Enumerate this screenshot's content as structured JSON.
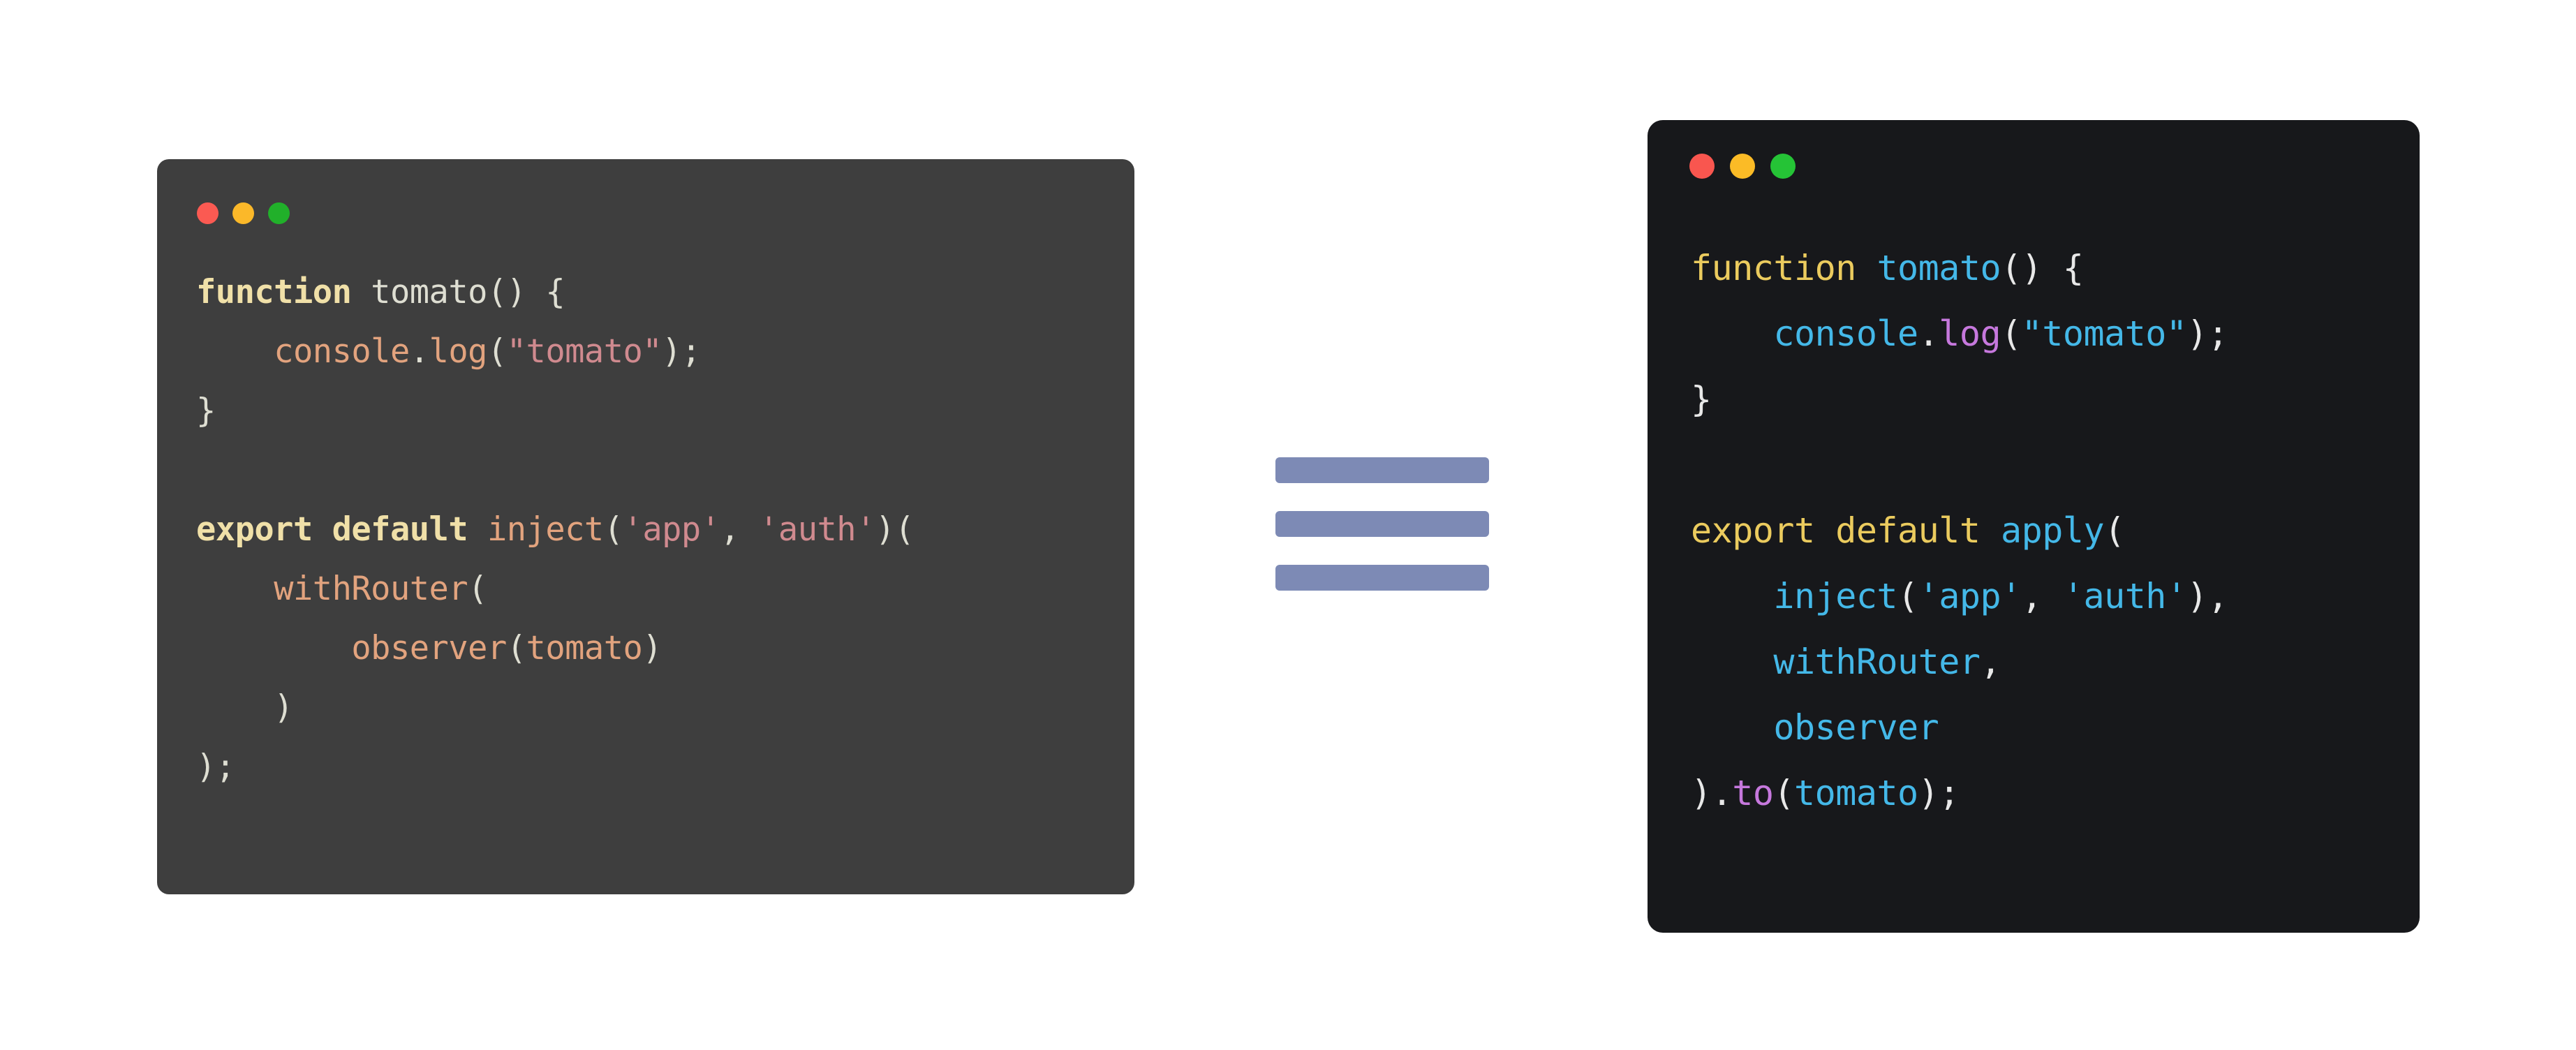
{
  "background_color": "#FFFFFF",
  "left_window": {
    "name": "before-code-window",
    "background_color": "#3E3E3E",
    "traffic_lights": [
      {
        "name": "close-dot",
        "color": "#FB5A52"
      },
      {
        "name": "minimize-dot",
        "color": "#FBB829"
      },
      {
        "name": "maximize-dot",
        "color": "#21B02A"
      }
    ],
    "language": "javascript",
    "code_text": "function tomato() {\n    console.log(\"tomato\");\n}\n\nexport default inject('app', 'auth')(\n    withRouter(\n        observer(tomato)\n    )\n);",
    "lines": [
      {
        "tokens": [
          {
            "text": "function",
            "type": "keyword"
          },
          {
            "text": " ",
            "type": "plain"
          },
          {
            "text": "tomato",
            "type": "plain"
          },
          {
            "text": "() {",
            "type": "punct"
          }
        ]
      },
      {
        "tokens": [
          {
            "text": "    ",
            "type": "plain"
          },
          {
            "text": "console",
            "type": "func"
          },
          {
            "text": ".",
            "type": "punct"
          },
          {
            "text": "log",
            "type": "func"
          },
          {
            "text": "(",
            "type": "punct"
          },
          {
            "text": "\"tomato\"",
            "type": "string"
          },
          {
            "text": ");",
            "type": "punct"
          }
        ]
      },
      {
        "tokens": [
          {
            "text": "}",
            "type": "punct"
          }
        ]
      },
      {
        "blank": true,
        "tokens": []
      },
      {
        "tokens": [
          {
            "text": "export default",
            "type": "keyword"
          },
          {
            "text": " ",
            "type": "plain"
          },
          {
            "text": "inject",
            "type": "func"
          },
          {
            "text": "(",
            "type": "punct"
          },
          {
            "text": "'app'",
            "type": "string"
          },
          {
            "text": ", ",
            "type": "punct"
          },
          {
            "text": "'auth'",
            "type": "string"
          },
          {
            "text": ")(",
            "type": "punct"
          }
        ]
      },
      {
        "tokens": [
          {
            "text": "    ",
            "type": "plain"
          },
          {
            "text": "withRouter",
            "type": "func"
          },
          {
            "text": "(",
            "type": "punct"
          }
        ]
      },
      {
        "tokens": [
          {
            "text": "        ",
            "type": "plain"
          },
          {
            "text": "observer",
            "type": "func"
          },
          {
            "text": "(",
            "type": "punct"
          },
          {
            "text": "tomato",
            "type": "func"
          },
          {
            "text": ")",
            "type": "punct"
          }
        ]
      },
      {
        "tokens": [
          {
            "text": "    )",
            "type": "punct"
          }
        ]
      },
      {
        "tokens": [
          {
            "text": ");",
            "type": "punct"
          }
        ]
      }
    ]
  },
  "equiv_symbol": {
    "name": "equivalence-symbol",
    "bar_color": "#7D8AB5",
    "bar_count": 3,
    "meaning": "equivalent-to"
  },
  "right_window": {
    "name": "after-code-window",
    "background_color": "#17181B",
    "traffic_lights": [
      {
        "name": "close-dot",
        "color": "#F9564F"
      },
      {
        "name": "minimize-dot",
        "color": "#FBBB26"
      },
      {
        "name": "maximize-dot",
        "color": "#25C336"
      }
    ],
    "language": "javascript",
    "code_text": "function tomato() {\n    console.log(\"tomato\");\n}\n\nexport default apply(\n    inject('app', 'auth'),\n    withRouter,\n    observer\n).to(tomato);",
    "lines": [
      {
        "tokens": [
          {
            "text": "function",
            "type": "keyword"
          },
          {
            "text": " ",
            "type": "plain"
          },
          {
            "text": "tomato",
            "type": "func"
          },
          {
            "text": "() {",
            "type": "punct"
          }
        ]
      },
      {
        "tokens": [
          {
            "text": "    ",
            "type": "plain"
          },
          {
            "text": "console",
            "type": "func"
          },
          {
            "text": ".",
            "type": "punct"
          },
          {
            "text": "log",
            "type": "method"
          },
          {
            "text": "(",
            "type": "punct"
          },
          {
            "text": "\"tomato\"",
            "type": "string"
          },
          {
            "text": ");",
            "type": "punct"
          }
        ]
      },
      {
        "tokens": [
          {
            "text": "}",
            "type": "punct"
          }
        ]
      },
      {
        "blank": true,
        "tokens": []
      },
      {
        "tokens": [
          {
            "text": "export default",
            "type": "keyword"
          },
          {
            "text": " ",
            "type": "plain"
          },
          {
            "text": "apply",
            "type": "func"
          },
          {
            "text": "(",
            "type": "punct"
          }
        ]
      },
      {
        "tokens": [
          {
            "text": "    ",
            "type": "plain"
          },
          {
            "text": "inject",
            "type": "func"
          },
          {
            "text": "(",
            "type": "punct"
          },
          {
            "text": "'app'",
            "type": "string"
          },
          {
            "text": ", ",
            "type": "punct"
          },
          {
            "text": "'auth'",
            "type": "string"
          },
          {
            "text": "),",
            "type": "punct"
          }
        ]
      },
      {
        "tokens": [
          {
            "text": "    ",
            "type": "plain"
          },
          {
            "text": "withRouter",
            "type": "func"
          },
          {
            "text": ",",
            "type": "punct"
          }
        ]
      },
      {
        "tokens": [
          {
            "text": "    ",
            "type": "plain"
          },
          {
            "text": "observer",
            "type": "func"
          }
        ]
      },
      {
        "tokens": [
          {
            "text": ").",
            "type": "punct"
          },
          {
            "text": "to",
            "type": "method"
          },
          {
            "text": "(",
            "type": "punct"
          },
          {
            "text": "tomato",
            "type": "func"
          },
          {
            "text": ");",
            "type": "punct"
          }
        ]
      }
    ]
  }
}
